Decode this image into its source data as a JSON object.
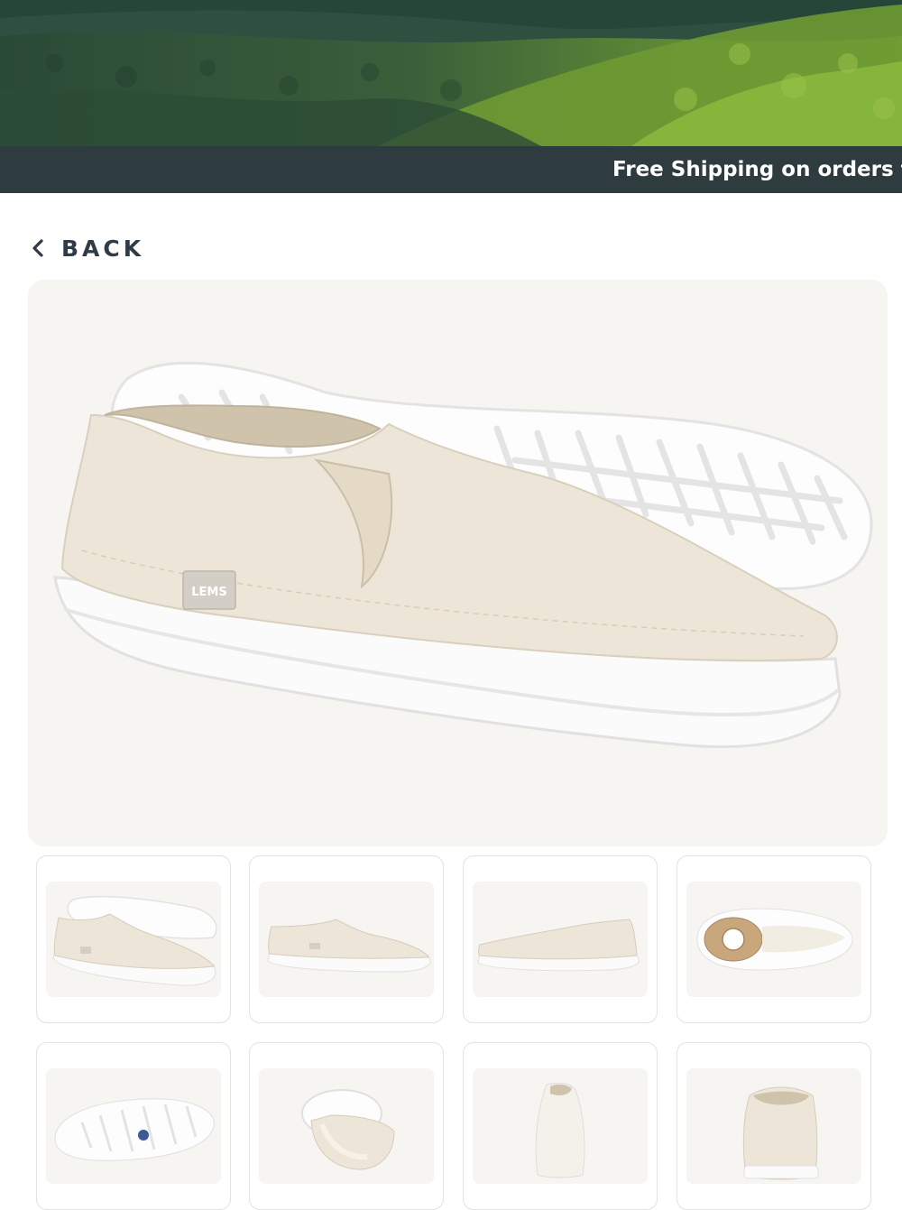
{
  "announcement": {
    "text": "Free Shipping on orders t"
  },
  "nav": {
    "back_label": "BACK"
  },
  "product_images": {
    "main_logo": "LEMS",
    "main_alt": "Cream canvas slip-on shoe shown from side with a second shoe showing its white tread sole",
    "thumbnails": [
      {
        "view": "pair-side-and-sole"
      },
      {
        "view": "side-left"
      },
      {
        "view": "side-right"
      },
      {
        "view": "top-insole"
      },
      {
        "view": "sole-bottom"
      },
      {
        "view": "rolled-flexibility"
      },
      {
        "view": "front"
      },
      {
        "view": "back"
      }
    ]
  },
  "colors": {
    "announcement_bg": "#2e3b3f",
    "announcement_text": "#ffffff",
    "back_text": "#2f3b47",
    "image_bg": "#f7f5f1",
    "thumb_border": "#e2e2e2",
    "shoe_canvas": "#ede6d8",
    "shoe_sole": "#fbfbfb"
  },
  "icons": {
    "back": "chevron-left-icon"
  }
}
